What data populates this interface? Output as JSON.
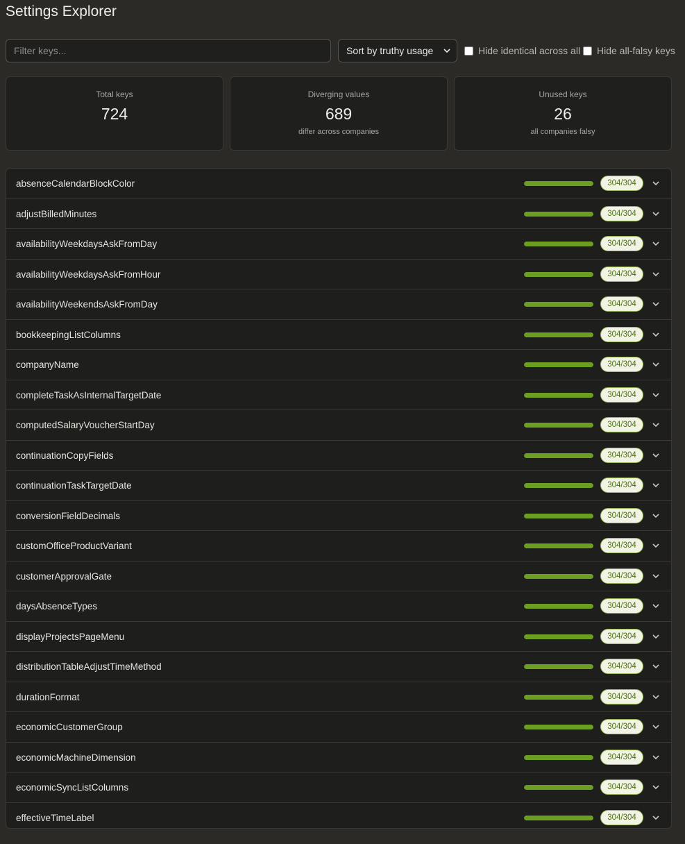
{
  "app": {
    "title": "Settings Explorer"
  },
  "toolbar": {
    "filter_placeholder": "Filter keys...",
    "filter_value": "",
    "sort_selected": "Sort by truthy usage",
    "hide_identical_label": "Hide identical across all",
    "hide_identical_checked": false,
    "hide_falsy_label": "Hide all-falsy keys",
    "hide_falsy_checked": false
  },
  "stats": [
    {
      "title": "Total keys",
      "value": "724",
      "sub": ""
    },
    {
      "title": "Diverging values",
      "value": "689",
      "sub": "differ across companies"
    },
    {
      "title": "Unused keys",
      "value": "26",
      "sub": "all companies falsy"
    }
  ],
  "colors": {
    "bar_fill": "#6c9e22",
    "badge_bg": "#f1f4e4",
    "badge_text": "#4f6f1a"
  },
  "rows": [
    {
      "name": "absenceCalendarBlockColor",
      "count": "304/304",
      "fraction": 1.0
    },
    {
      "name": "adjustBilledMinutes",
      "count": "304/304",
      "fraction": 1.0
    },
    {
      "name": "availabilityWeekdaysAskFromDay",
      "count": "304/304",
      "fraction": 1.0
    },
    {
      "name": "availabilityWeekdaysAskFromHour",
      "count": "304/304",
      "fraction": 1.0
    },
    {
      "name": "availabilityWeekendsAskFromDay",
      "count": "304/304",
      "fraction": 1.0
    },
    {
      "name": "bookkeepingListColumns",
      "count": "304/304",
      "fraction": 1.0
    },
    {
      "name": "companyName",
      "count": "304/304",
      "fraction": 1.0
    },
    {
      "name": "completeTaskAsInternalTargetDate",
      "count": "304/304",
      "fraction": 1.0
    },
    {
      "name": "computedSalaryVoucherStartDay",
      "count": "304/304",
      "fraction": 1.0
    },
    {
      "name": "continuationCopyFields",
      "count": "304/304",
      "fraction": 1.0
    },
    {
      "name": "continuationTaskTargetDate",
      "count": "304/304",
      "fraction": 1.0
    },
    {
      "name": "conversionFieldDecimals",
      "count": "304/304",
      "fraction": 1.0
    },
    {
      "name": "customOfficeProductVariant",
      "count": "304/304",
      "fraction": 1.0
    },
    {
      "name": "customerApprovalGate",
      "count": "304/304",
      "fraction": 1.0
    },
    {
      "name": "daysAbsenceTypes",
      "count": "304/304",
      "fraction": 1.0
    },
    {
      "name": "displayProjectsPageMenu",
      "count": "304/304",
      "fraction": 1.0
    },
    {
      "name": "distributionTableAdjustTimeMethod",
      "count": "304/304",
      "fraction": 1.0
    },
    {
      "name": "durationFormat",
      "count": "304/304",
      "fraction": 1.0
    },
    {
      "name": "economicCustomerGroup",
      "count": "304/304",
      "fraction": 1.0
    },
    {
      "name": "economicMachineDimension",
      "count": "304/304",
      "fraction": 1.0
    },
    {
      "name": "economicSyncListColumns",
      "count": "304/304",
      "fraction": 1.0
    },
    {
      "name": "effectiveTimeLabel",
      "count": "304/304",
      "fraction": 1.0
    }
  ]
}
